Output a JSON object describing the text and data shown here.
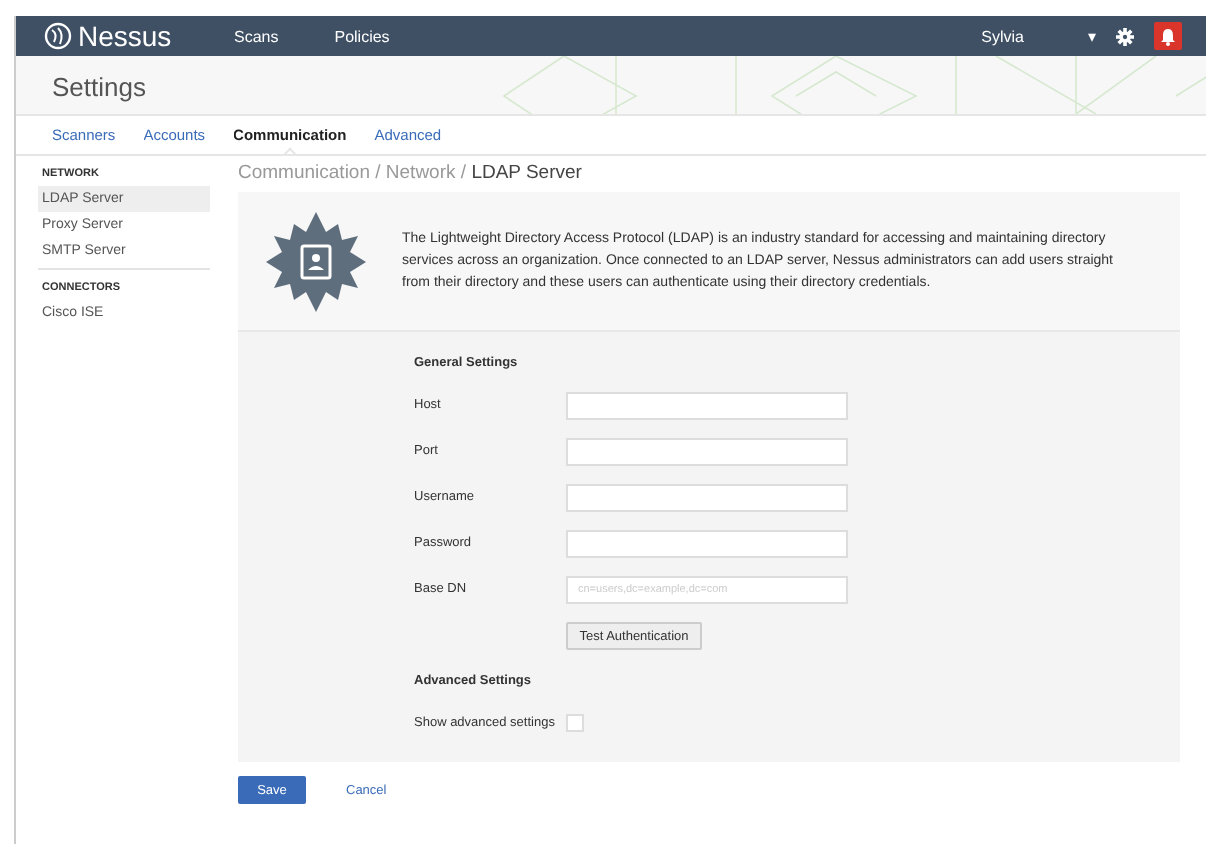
{
  "navbar": {
    "logo": "Nessus",
    "links": [
      "Scans",
      "Policies"
    ],
    "user": "Sylvia",
    "caret": "▾"
  },
  "header": {
    "title": "Settings"
  },
  "tabs": [
    {
      "label": "Scanners",
      "selected": false
    },
    {
      "label": "Accounts",
      "selected": false
    },
    {
      "label": "Communication",
      "selected": true
    },
    {
      "label": "Advanced",
      "selected": false
    }
  ],
  "sidebar": {
    "sections": [
      {
        "heading": "NETWORK",
        "items": [
          {
            "label": "LDAP Server",
            "selected": true
          },
          {
            "label": "Proxy Server",
            "selected": false
          },
          {
            "label": "SMTP Server",
            "selected": false
          }
        ]
      },
      {
        "heading": "CONNECTORS",
        "items": [
          {
            "label": "Cisco ISE",
            "selected": false
          }
        ]
      }
    ]
  },
  "breadcrumb": {
    "path": "Communication / Network / ",
    "current": "LDAP Server"
  },
  "intro": "The Lightweight Directory Access Protocol (LDAP) is an industry standard for accessing and maintaining directory services across an organization. Once connected to an LDAP server, Nessus administrators can add users straight from their directory and these users can authenticate using their directory credentials.",
  "form": {
    "heading": "General Settings",
    "fields": [
      {
        "label": "Host"
      },
      {
        "label": "Port"
      },
      {
        "label": "Username"
      },
      {
        "label": "Password"
      },
      {
        "label": "Base DN",
        "placeholder": "cn=users,dc=example,dc=com"
      }
    ],
    "test_button": "Test Authentication",
    "advanced_heading": "Advanced Settings",
    "advanced_toggle": {
      "label": "Show advanced settings",
      "checked": false
    }
  },
  "actions": {
    "save": "Save",
    "cancel": "Cancel"
  }
}
